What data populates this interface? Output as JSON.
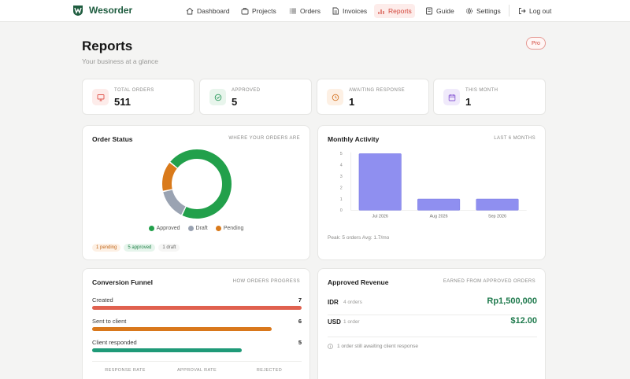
{
  "app": {
    "name": "Wesorder"
  },
  "nav": {
    "items": [
      {
        "label": "Dashboard",
        "icon": "home-icon"
      },
      {
        "label": "Projects",
        "icon": "briefcase-icon"
      },
      {
        "label": "Orders",
        "icon": "list-icon"
      },
      {
        "label": "Invoices",
        "icon": "document-icon"
      },
      {
        "label": "Reports",
        "icon": "chart-icon",
        "active": true
      },
      {
        "label": "Guide",
        "icon": "book-icon"
      },
      {
        "label": "Settings",
        "icon": "gear-icon"
      }
    ],
    "logout": "Log out"
  },
  "header": {
    "title": "Reports",
    "subtitle": "Your business at a glance",
    "badge": "Pro"
  },
  "stats": [
    {
      "label": "TOTAL ORDERS",
      "value": "511",
      "icon": "monitor-icon",
      "color": "#e0524a",
      "bg": "#fdecea"
    },
    {
      "label": "APPROVED",
      "value": "5",
      "icon": "check-circle-icon",
      "color": "#2a9a5c",
      "bg": "#e8f5ec"
    },
    {
      "label": "AWAITING RESPONSE",
      "value": "1",
      "icon": "clock-icon",
      "color": "#d5782b",
      "bg": "#fdf0e4"
    },
    {
      "label": "THIS MONTH",
      "value": "1",
      "icon": "calendar-icon",
      "color": "#8a5cd4",
      "bg": "#f0eafb"
    }
  ],
  "order_status": {
    "title": "Order Status",
    "caption": "WHERE YOUR ORDERS ARE",
    "legend": [
      {
        "label": "Approved",
        "color": "#22a04b"
      },
      {
        "label": "Draft",
        "color": "#9aa3b2"
      },
      {
        "label": "Pending",
        "color": "#d97a1b"
      }
    ],
    "pills": [
      "1 pending",
      "5 approved",
      "1 draft"
    ]
  },
  "monthly": {
    "title": "Monthly Activity",
    "caption": "LAST 6 MONTHS",
    "peak_text": "Peak: 5 orders  Avg: 1.7/mo"
  },
  "funnel": {
    "title": "Conversion Funnel",
    "caption": "HOW ORDERS PROGRESS",
    "rows": [
      {
        "label": "Created",
        "count": "7",
        "fraction": 1.0,
        "color": "#e0614f"
      },
      {
        "label": "Sent to client",
        "count": "6",
        "fraction": 0.857,
        "color": "#d9781c"
      },
      {
        "label": "Client responded",
        "count": "5",
        "fraction": 0.714,
        "color": "#1f9a78"
      }
    ],
    "metrics": [
      {
        "label": "RESPONSE RATE"
      },
      {
        "label": "APPROVAL RATE"
      },
      {
        "label": "REJECTED"
      }
    ]
  },
  "revenue": {
    "title": "Approved Revenue",
    "caption": "EARNED FROM APPROVED ORDERS",
    "rows": [
      {
        "currency": "IDR",
        "orders": "4 orders",
        "amount": "Rp1,500,000"
      },
      {
        "currency": "USD",
        "orders": "1 order",
        "amount": "$12.00"
      }
    ],
    "note": "1 order still awaiting client response"
  },
  "chart_data": [
    {
      "type": "pie",
      "title": "Order Status",
      "categories": [
        "Approved",
        "Draft",
        "Pending"
      ],
      "values": [
        5,
        1,
        1
      ],
      "colors": [
        "#22a04b",
        "#9aa3b2",
        "#d97a1b"
      ]
    },
    {
      "type": "bar",
      "title": "Monthly Activity",
      "categories": [
        "Jul 2026",
        "Aug 2026",
        "Sep 2026"
      ],
      "values": [
        5,
        1,
        1
      ],
      "ylim": [
        0,
        5
      ],
      "yticks": [
        0,
        1,
        2,
        3,
        4,
        5
      ],
      "color": "#8f8ff0",
      "grid": false
    }
  ]
}
